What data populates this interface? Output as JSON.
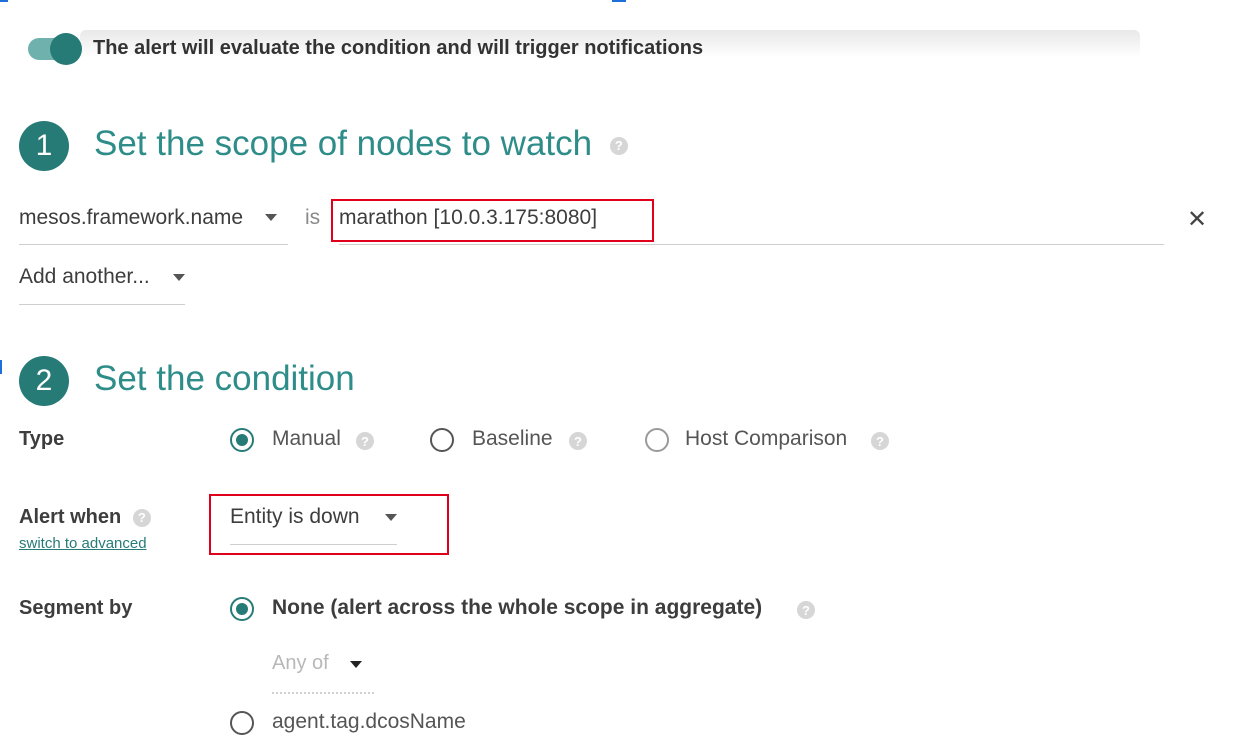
{
  "toggle": {
    "state": "on",
    "text": "The alert will evaluate the condition and will trigger notifications"
  },
  "step1": {
    "number": "1",
    "title": "Set the scope of nodes to watch",
    "help_icon": "question-icon",
    "scope_key": "mesos.framework.name",
    "operator": "is",
    "scope_value": "marathon [10.0.3.175:8080]",
    "remove_icon": "close-icon",
    "add_another": "Add another..."
  },
  "step2": {
    "number": "2",
    "title": "Set the condition",
    "type_label": "Type",
    "type_options": [
      "Manual",
      "Baseline",
      "Host Comparison"
    ],
    "type_selected": "Manual",
    "alert_when_label": "Alert when",
    "switch_link": "switch to advanced",
    "alert_when_value": "Entity is down",
    "segment_label": "Segment by",
    "segment_none": "None (alert across the whole scope in aggregate)",
    "any_of": "Any of",
    "segment_other": "agent.tag.dcosName"
  },
  "colors": {
    "accent": "#277b77",
    "title_teal": "#2e8d89",
    "highlight_red": "#e0001b"
  }
}
